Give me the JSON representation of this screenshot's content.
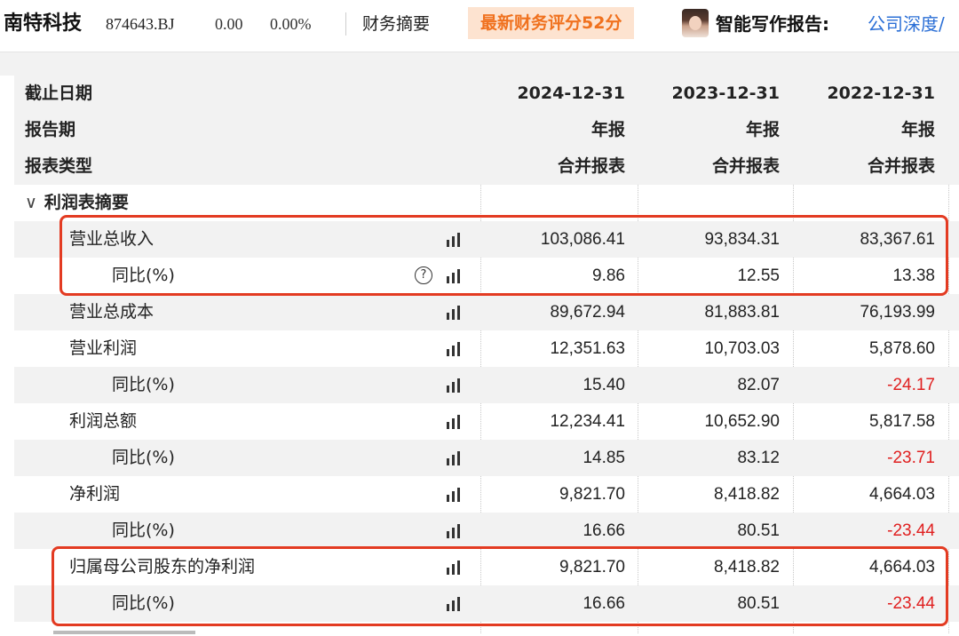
{
  "header": {
    "company": "南特科技",
    "code": "874643.BJ",
    "price": "0.00",
    "change_pct": "0.00%",
    "tab_summary": "财务摘要",
    "score_badge": "最新财务评分52分",
    "ai_label": "智能写作报告:",
    "ai_link": "公司深度/"
  },
  "table": {
    "header_rows": [
      {
        "label": "截止日期",
        "values": [
          "2024-12-31",
          "2023-12-31",
          "2022-12-31"
        ]
      },
      {
        "label": "报告期",
        "values": [
          "年报",
          "年报",
          "年报"
        ]
      },
      {
        "label": "报表类型",
        "values": [
          "合并报表",
          "合并报表",
          "合并报表"
        ]
      }
    ],
    "section": {
      "chevron": "∨",
      "label": "利润表摘要"
    },
    "rows": [
      {
        "label": "营业总收入",
        "level": 1,
        "help": false,
        "values": [
          "103,086.41",
          "93,834.31",
          "83,367.61"
        ]
      },
      {
        "label": "同比(%)",
        "level": 2,
        "help": true,
        "help_glyph": "?",
        "values": [
          "9.86",
          "12.55",
          "13.38"
        ]
      },
      {
        "label": "营业总成本",
        "level": 1,
        "help": false,
        "values": [
          "89,672.94",
          "81,883.81",
          "76,193.99"
        ]
      },
      {
        "label": "营业利润",
        "level": 1,
        "help": false,
        "values": [
          "12,351.63",
          "10,703.03",
          "5,878.60"
        ]
      },
      {
        "label": "同比(%)",
        "level": 2,
        "help": false,
        "values": [
          "15.40",
          "82.07",
          "-24.17"
        ]
      },
      {
        "label": "利润总额",
        "level": 1,
        "help": false,
        "values": [
          "12,234.41",
          "10,652.90",
          "5,817.58"
        ]
      },
      {
        "label": "同比(%)",
        "level": 2,
        "help": false,
        "values": [
          "14.85",
          "83.12",
          "-23.71"
        ]
      },
      {
        "label": "净利润",
        "level": 1,
        "help": false,
        "values": [
          "9,821.70",
          "8,418.82",
          "4,664.03"
        ]
      },
      {
        "label": "同比(%)",
        "level": 2,
        "help": false,
        "values": [
          "16.66",
          "80.51",
          "-23.44"
        ]
      },
      {
        "label": "归属母公司股东的净利润",
        "level": 1,
        "help": false,
        "values": [
          "9,821.70",
          "8,418.82",
          "4,664.03"
        ]
      },
      {
        "label": "同比(%)",
        "level": 2,
        "help": false,
        "values": [
          "16.66",
          "80.51",
          "-23.44"
        ]
      }
    ]
  },
  "colors": {
    "accent_orange": "#f0711e",
    "badge_bg": "#fde3d0",
    "negative": "#e02020",
    "link": "#2b6fd6",
    "highlight_box": "#e33b22",
    "row_shade": "#f2f2f2"
  },
  "icons": {
    "chart": "bar-chart-icon",
    "help": "help-circle-icon",
    "collapse": "chevron-down-icon"
  }
}
